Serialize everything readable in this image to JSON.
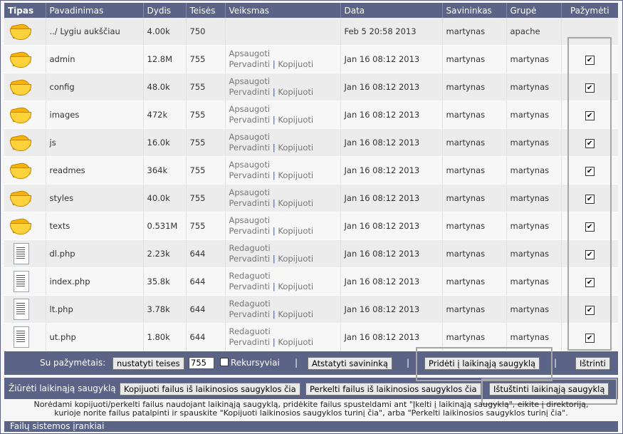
{
  "columns": [
    "Tipas",
    "Pavadinimas",
    "Dydis",
    "Teisės",
    "Veiksmas",
    "Data",
    "Savininkas",
    "Grupė",
    "Pažymėti"
  ],
  "parent_row": {
    "name": "../ Lygiu aukščiau",
    "size": "4.00k",
    "perm": "750",
    "date": "Feb 5 20:58 2013",
    "owner": "martynas",
    "group": "apache"
  },
  "rows": [
    {
      "type": "folder",
      "name": "admin",
      "size": "12.8M",
      "perm": "755",
      "a1": "Apsaugoti",
      "a2": "Pervadinti",
      "a3": "Kopijuoti",
      "date": "Jan 16 08:12 2013",
      "owner": "martynas",
      "group": "martynas",
      "checked": "✔"
    },
    {
      "type": "folder",
      "name": "config",
      "size": "48.0k",
      "perm": "755",
      "a1": "Apsaugoti",
      "a2": "Pervadinti",
      "a3": "Kopijuoti",
      "date": "Jan 16 08:12 2013",
      "owner": "martynas",
      "group": "martynas",
      "checked": "✔"
    },
    {
      "type": "folder",
      "name": "images",
      "size": "472k",
      "perm": "755",
      "a1": "Apsaugoti",
      "a2": "Pervadinti",
      "a3": "Kopijuoti",
      "date": "Jan 16 08:12 2013",
      "owner": "martynas",
      "group": "martynas",
      "checked": "✔"
    },
    {
      "type": "folder",
      "name": "js",
      "size": "16.0k",
      "perm": "755",
      "a1": "Apsaugoti",
      "a2": "Pervadinti",
      "a3": "Kopijuoti",
      "date": "Jan 16 08:12 2013",
      "owner": "martynas",
      "group": "martynas",
      "checked": "✔"
    },
    {
      "type": "folder",
      "name": "readmes",
      "size": "364k",
      "perm": "755",
      "a1": "Apsaugoti",
      "a2": "Pervadinti",
      "a3": "Kopijuoti",
      "date": "Jan 16 08:12 2013",
      "owner": "martynas",
      "group": "martynas",
      "checked": "✔"
    },
    {
      "type": "folder",
      "name": "styles",
      "size": "40.0k",
      "perm": "755",
      "a1": "Apsaugoti",
      "a2": "Pervadinti",
      "a3": "Kopijuoti",
      "date": "Jan 16 08:12 2013",
      "owner": "martynas",
      "group": "martynas",
      "checked": "✔"
    },
    {
      "type": "folder",
      "name": "texts",
      "size": "0.531M",
      "perm": "755",
      "a1": "Apsaugoti",
      "a2": "Pervadinti",
      "a3": "Kopijuoti",
      "date": "Jan 16 08:12 2013",
      "owner": "martynas",
      "group": "martynas",
      "checked": "✔"
    },
    {
      "type": "file",
      "name": "dl.php",
      "size": "2.23k",
      "perm": "644",
      "a1": "Redaguoti",
      "a2": "Pervadinti",
      "a3": "Kopijuoti",
      "date": "Jan 16 08:12 2013",
      "owner": "martynas",
      "group": "martynas",
      "checked": "✔"
    },
    {
      "type": "file",
      "name": "index.php",
      "size": "35.8k",
      "perm": "644",
      "a1": "Redaguoti",
      "a2": "Pervadinti",
      "a3": "Kopijuoti",
      "date": "Jan 16 08:12 2013",
      "owner": "martynas",
      "group": "martynas",
      "checked": "✔"
    },
    {
      "type": "file",
      "name": "lt.php",
      "size": "3.78k",
      "perm": "644",
      "a1": "Redaguoti",
      "a2": "Pervadinti",
      "a3": "Kopijuoti",
      "date": "Jan 16 08:12 2013",
      "owner": "martynas",
      "group": "martynas",
      "checked": "✔"
    },
    {
      "type": "file",
      "name": "ut.php",
      "size": "1.80k",
      "perm": "644",
      "a1": "Redaguoti",
      "a2": "Pervadinti",
      "a3": "Kopijuoti",
      "date": "Jan 16 08:12 2013",
      "owner": "martynas",
      "group": "martynas",
      "checked": "✔"
    }
  ],
  "toolbar1": {
    "label": "Su pažymėtais:",
    "set_perm_btn": "nustatyti teises",
    "perm_value": "755",
    "recursive_label": "Rekursyviai",
    "reset_owner_btn": "Atstatyti savininką",
    "sep": "|",
    "add_clipboard_btn": "Pridėti į laikinąją saugyklą",
    "delete_btn": "Ištrinti"
  },
  "toolbar2": {
    "label": "Žiūrėti laikinąją saugyklą",
    "copy_btn": "Kopijuoti failus iš laikinosios saugyklos čia",
    "move_btn": "Perkelti failus iš laikinosios saugyklos čia",
    "clear_btn": "Ištuštinti laikinąją saugyklą"
  },
  "note": {
    "line1": "Norėdami kopijuoti/perkelti failus naudojant laikinąją saugyklą, pridėkite failus spusteldami ant \"Įkelti į laikinąją saugyklą\", eikite į direktoriją,",
    "line2": "kurioje norite failus patalpinti ir spauskite \"Kopijuoti laikinosios saugyklos turinį čia\", arba \"Perkelti laikinosios saugyklos turinį čia\"."
  },
  "footer": {
    "label": "Failų sistemos įrankiai"
  }
}
